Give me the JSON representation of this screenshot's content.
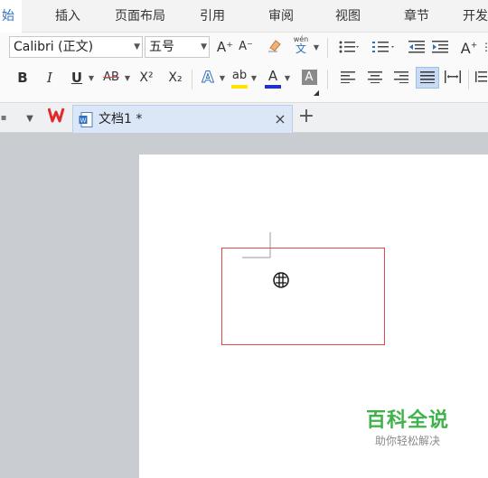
{
  "menu": {
    "items": [
      "始",
      "插入",
      "页面布局",
      "引用",
      "审阅",
      "视图",
      "章节",
      "开发"
    ]
  },
  "ribbon": {
    "font_name": "Calibri (正文)",
    "font_size": "五号",
    "bold": "B",
    "italic": "I",
    "underline": "U",
    "strikethrough": "AB",
    "superscript": "X²",
    "subscript": "X₂",
    "grow_font": "A⁺",
    "shrink_font": "A⁻",
    "phonetic_top": "wén",
    "phonetic_bottom": "文",
    "text_effect": "A",
    "highlight": "ab",
    "font_color": "A",
    "char_shading": "A",
    "colors": {
      "highlight": "#ffe400",
      "font_color": "#2130c8",
      "text_effect": "#2f6fc0"
    }
  },
  "tabs": {
    "doc_title": "文档1 *",
    "close": "×",
    "new_tab": "+"
  },
  "watermark": {
    "brand": "百科全说",
    "slogan": "助你轻松解决"
  }
}
